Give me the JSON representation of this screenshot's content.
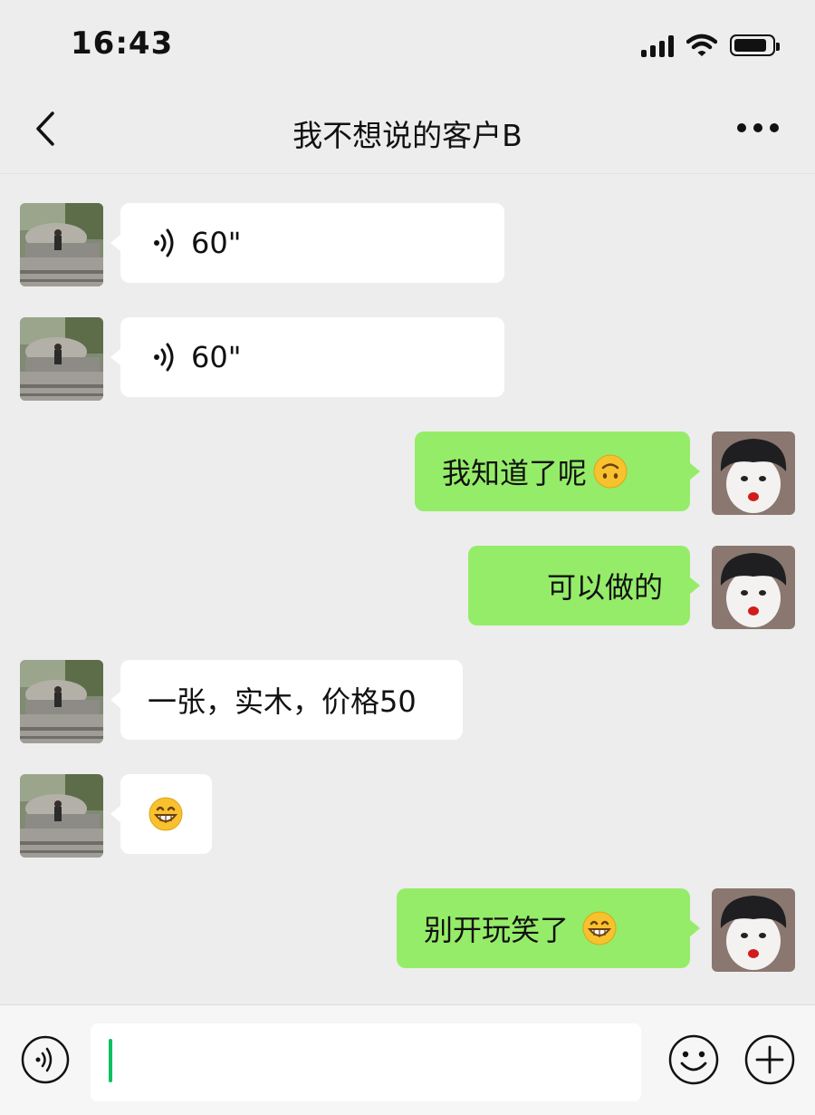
{
  "status_bar": {
    "time": "16:43"
  },
  "nav": {
    "title": "我不想说的客户B"
  },
  "messages": [
    {
      "side": "left",
      "type": "voice",
      "text": "60\""
    },
    {
      "side": "left",
      "type": "voice",
      "text": "60\""
    },
    {
      "side": "right",
      "type": "text",
      "text": "我知道了呢",
      "emoji": "upside-down-face-emoji"
    },
    {
      "side": "right",
      "type": "text",
      "text": "可以做的"
    },
    {
      "side": "left",
      "type": "text",
      "text": "一张，实木，价格50"
    },
    {
      "side": "left",
      "type": "emoji",
      "emoji": "grinning-face-emoji"
    },
    {
      "side": "right",
      "type": "text",
      "text": "别开玩笑了",
      "emoji": "grinning-face-emoji"
    }
  ],
  "input_bar": {
    "value": "",
    "placeholder": ""
  },
  "colors": {
    "background": "#ededed",
    "sent_bubble": "#95ec69",
    "received_bubble": "#ffffff",
    "caret": "#07c160"
  }
}
